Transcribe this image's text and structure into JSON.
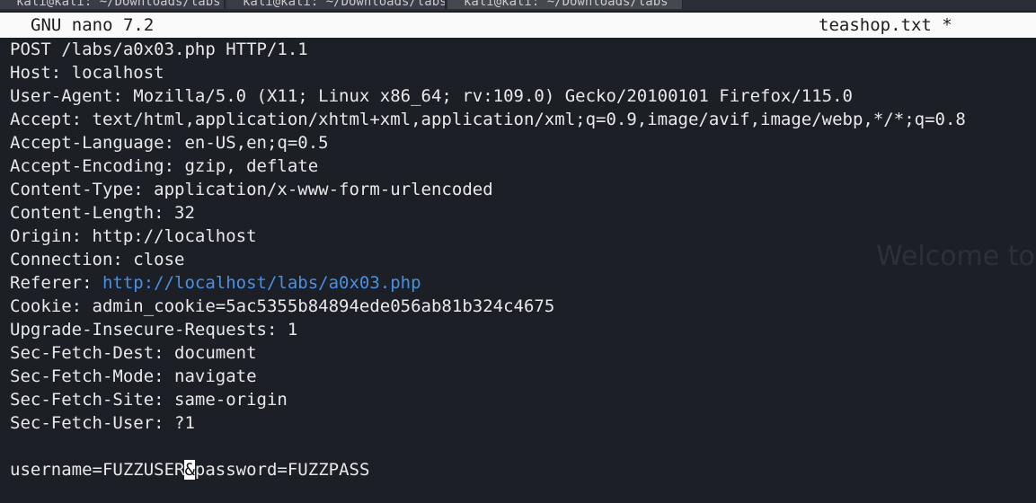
{
  "tabs": [
    {
      "label": "kali@kali: ~/Downloads/labs"
    },
    {
      "label": "kali@kali: ~/Downloads/labs"
    },
    {
      "label": "kali@kali: ~/Downloads/labs"
    }
  ],
  "nano": {
    "version_label": "GNU nano 7.2",
    "filename": "teashop.txt *"
  },
  "background_text": "Welcome to",
  "file": {
    "lines": [
      "POST /labs/a0x03.php HTTP/1.1",
      "Host: localhost",
      "User-Agent: Mozilla/5.0 (X11; Linux x86_64; rv:109.0) Gecko/20100101 Firefox/115.0",
      "Accept: text/html,application/xhtml+xml,application/xml;q=0.9,image/avif,image/webp,*/*;q=0.8",
      "Accept-Language: en-US,en;q=0.5",
      "Accept-Encoding: gzip, deflate",
      "Content-Type: application/x-www-form-urlencoded",
      "Content-Length: 32",
      "Origin: http://localhost",
      "Connection: close",
      "",
      "Cookie: admin_cookie=5ac5355b84894ede056ab81b324c4675",
      "Upgrade-Insecure-Requests: 1",
      "Sec-Fetch-Dest: document",
      "Sec-Fetch-Mode: navigate",
      "Sec-Fetch-Site: same-origin",
      "Sec-Fetch-User: ?1",
      ""
    ],
    "referer": {
      "key": "Referer: ",
      "url": "http://localhost/labs/a0x03.php"
    },
    "body": {
      "before_cursor": "username=FUZZUSER",
      "cursor_char": "&",
      "after_cursor": "password=FUZZPASS"
    }
  },
  "colors": {
    "background": "#1c1f26",
    "text": "#e9e9ea",
    "link": "#4a90e2",
    "titlebar": "#fafafa"
  }
}
